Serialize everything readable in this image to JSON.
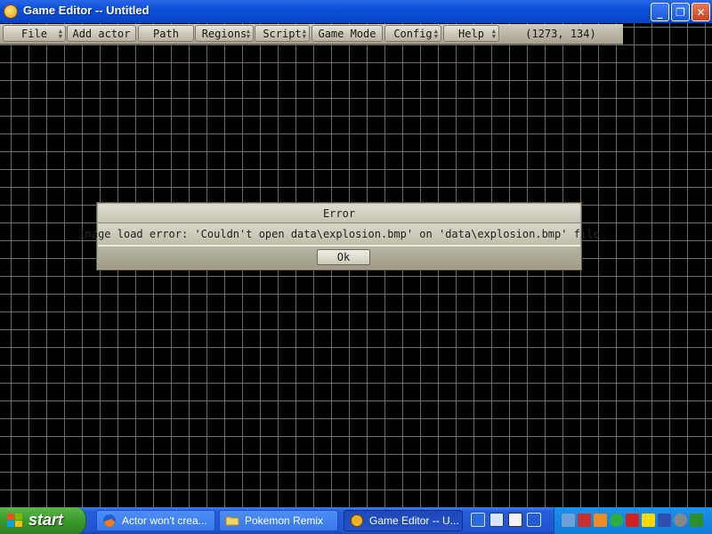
{
  "window": {
    "title": "Game Editor -- Untitled",
    "minimize_glyph": "_",
    "maximize_glyph": "❐",
    "close_glyph": "✕"
  },
  "menu": {
    "items": [
      {
        "label": "File"
      },
      {
        "label": "Add actor"
      },
      {
        "label": "Path"
      },
      {
        "label": "Regions"
      },
      {
        "label": "Script"
      },
      {
        "label": "Game Mode"
      },
      {
        "label": "Config"
      },
      {
        "label": "Help"
      }
    ],
    "coordinates": "(1273, 134)"
  },
  "dialog": {
    "title": "Error",
    "message": "Image load error: 'Couldn't open data\\explosion.bmp' on 'data\\explosion.bmp' file",
    "ok_label": "Ok"
  },
  "taskbar": {
    "start_label": "start",
    "tasks": [
      {
        "label": "Actor won't crea...",
        "icon": "firefox-icon"
      },
      {
        "label": "Pokemon Remix",
        "icon": "folder-icon"
      },
      {
        "label": "Game Editor -- U...",
        "icon": "game-editor-icon",
        "active": true
      }
    ]
  },
  "colors": {
    "titlebar": "#0a4fd8",
    "grid_line": "#6a6a6a",
    "canvas_bg": "#000000",
    "dialog_panel": "#c9c5b6",
    "start_green": "#3a9a2c",
    "taskbar_blue": "#245edb"
  }
}
